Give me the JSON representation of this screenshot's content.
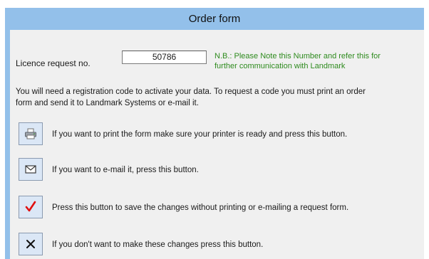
{
  "window": {
    "title": "Order form"
  },
  "licence": {
    "label": "Licence request no.",
    "value": "50786",
    "note_line1": "N.B.: Please Note this Number and refer this for",
    "note_line2": "further communication with Landmark"
  },
  "info": {
    "line1": "You will need a registration code to activate your data. To request a code you must print an order",
    "line2": "form and send it to Landmark Systems or e-mail it."
  },
  "actions": [
    {
      "icon": "printer-icon",
      "label": "If you want to print the form make sure your printer is ready and press this button."
    },
    {
      "icon": "envelope-icon",
      "label": "If you want to e-mail it, press this button."
    },
    {
      "icon": "checkmark-icon",
      "label": "Press this button to save the changes without printing or e-mailing a request form."
    },
    {
      "icon": "close-icon",
      "label": "If you don't want to make these changes press this button."
    }
  ],
  "colors": {
    "titlebar": "#93c0ea",
    "note": "#2e8b1e",
    "check": "#e01010"
  }
}
